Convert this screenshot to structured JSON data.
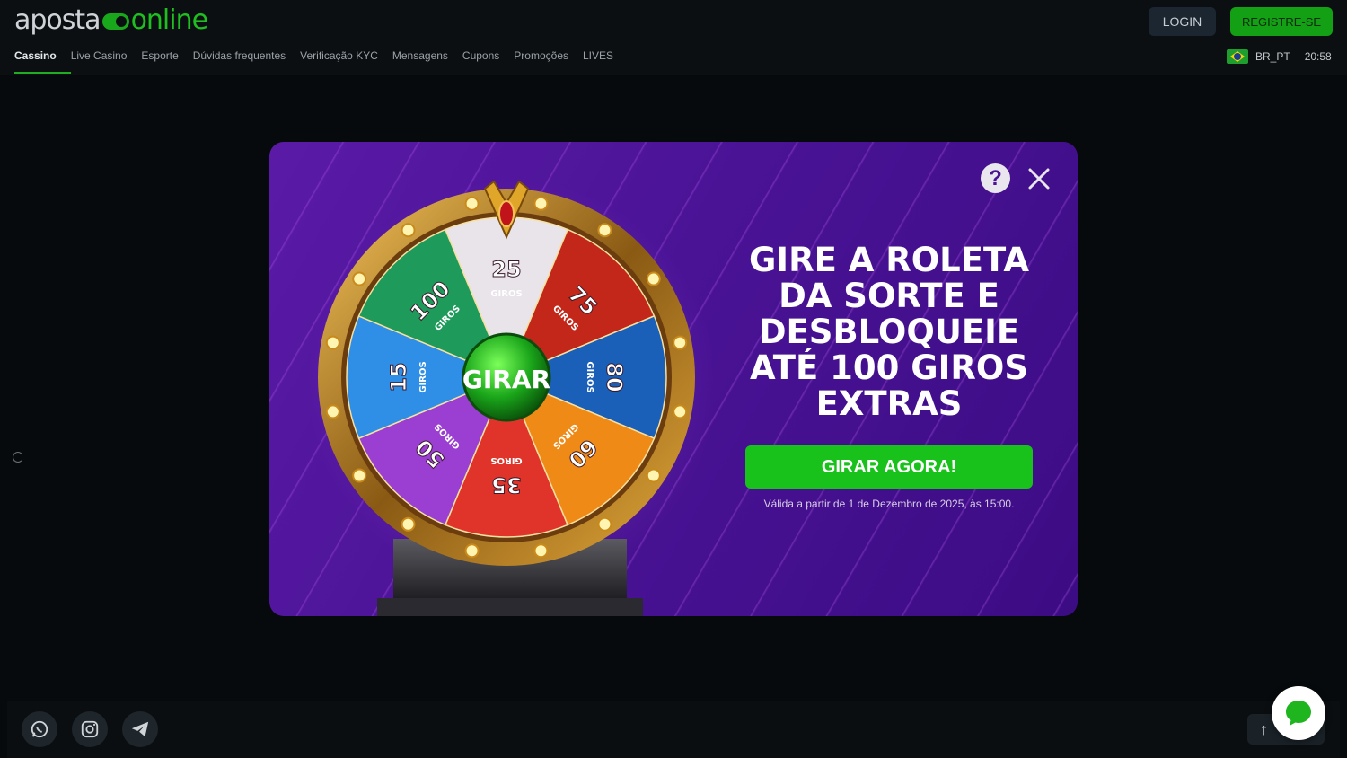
{
  "header": {
    "logo": {
      "part1": "aposta",
      "part2": "online"
    },
    "login_label": "LOGIN",
    "register_label": "REGISTRE-SE",
    "nav": [
      "Cassino",
      "Live Casino",
      "Esporte",
      "Dúvidas frequentes",
      "Verificação KYC",
      "Mensagens",
      "Cupons",
      "Promoções",
      "LIVES"
    ],
    "active_nav": "Cassino",
    "locale": "BR_PT",
    "time": "20:58"
  },
  "modal": {
    "title_lines": [
      "GIRE A ROLETA",
      "DA SORTE E",
      "DESBLOQUEIE",
      "ATÉ 100 GIROS",
      "EXTRAS"
    ],
    "cta_label": "GIRAR AGORA!",
    "validity": "Válida a partir de 1 de Dezembro de 2025, às 15:00.",
    "wheel": {
      "center_label": "GIRAR",
      "unit_label": "GIROS",
      "segments": [
        {
          "value": "25",
          "color": "#e9e4ea"
        },
        {
          "value": "75",
          "color": "#c2271a"
        },
        {
          "value": "80",
          "color": "#1a5fb8"
        },
        {
          "value": "60",
          "color": "#f08a16"
        },
        {
          "value": "35",
          "color": "#e0342a"
        },
        {
          "value": "50",
          "color": "#9a3fd1"
        },
        {
          "value": "15",
          "color": "#2f8ee6"
        },
        {
          "value": "100",
          "color": "#1e9a5a"
        }
      ]
    }
  },
  "footer": {
    "social": [
      "whatsapp-icon",
      "instagram-icon",
      "telegram-icon"
    ],
    "up_label": "↑"
  }
}
